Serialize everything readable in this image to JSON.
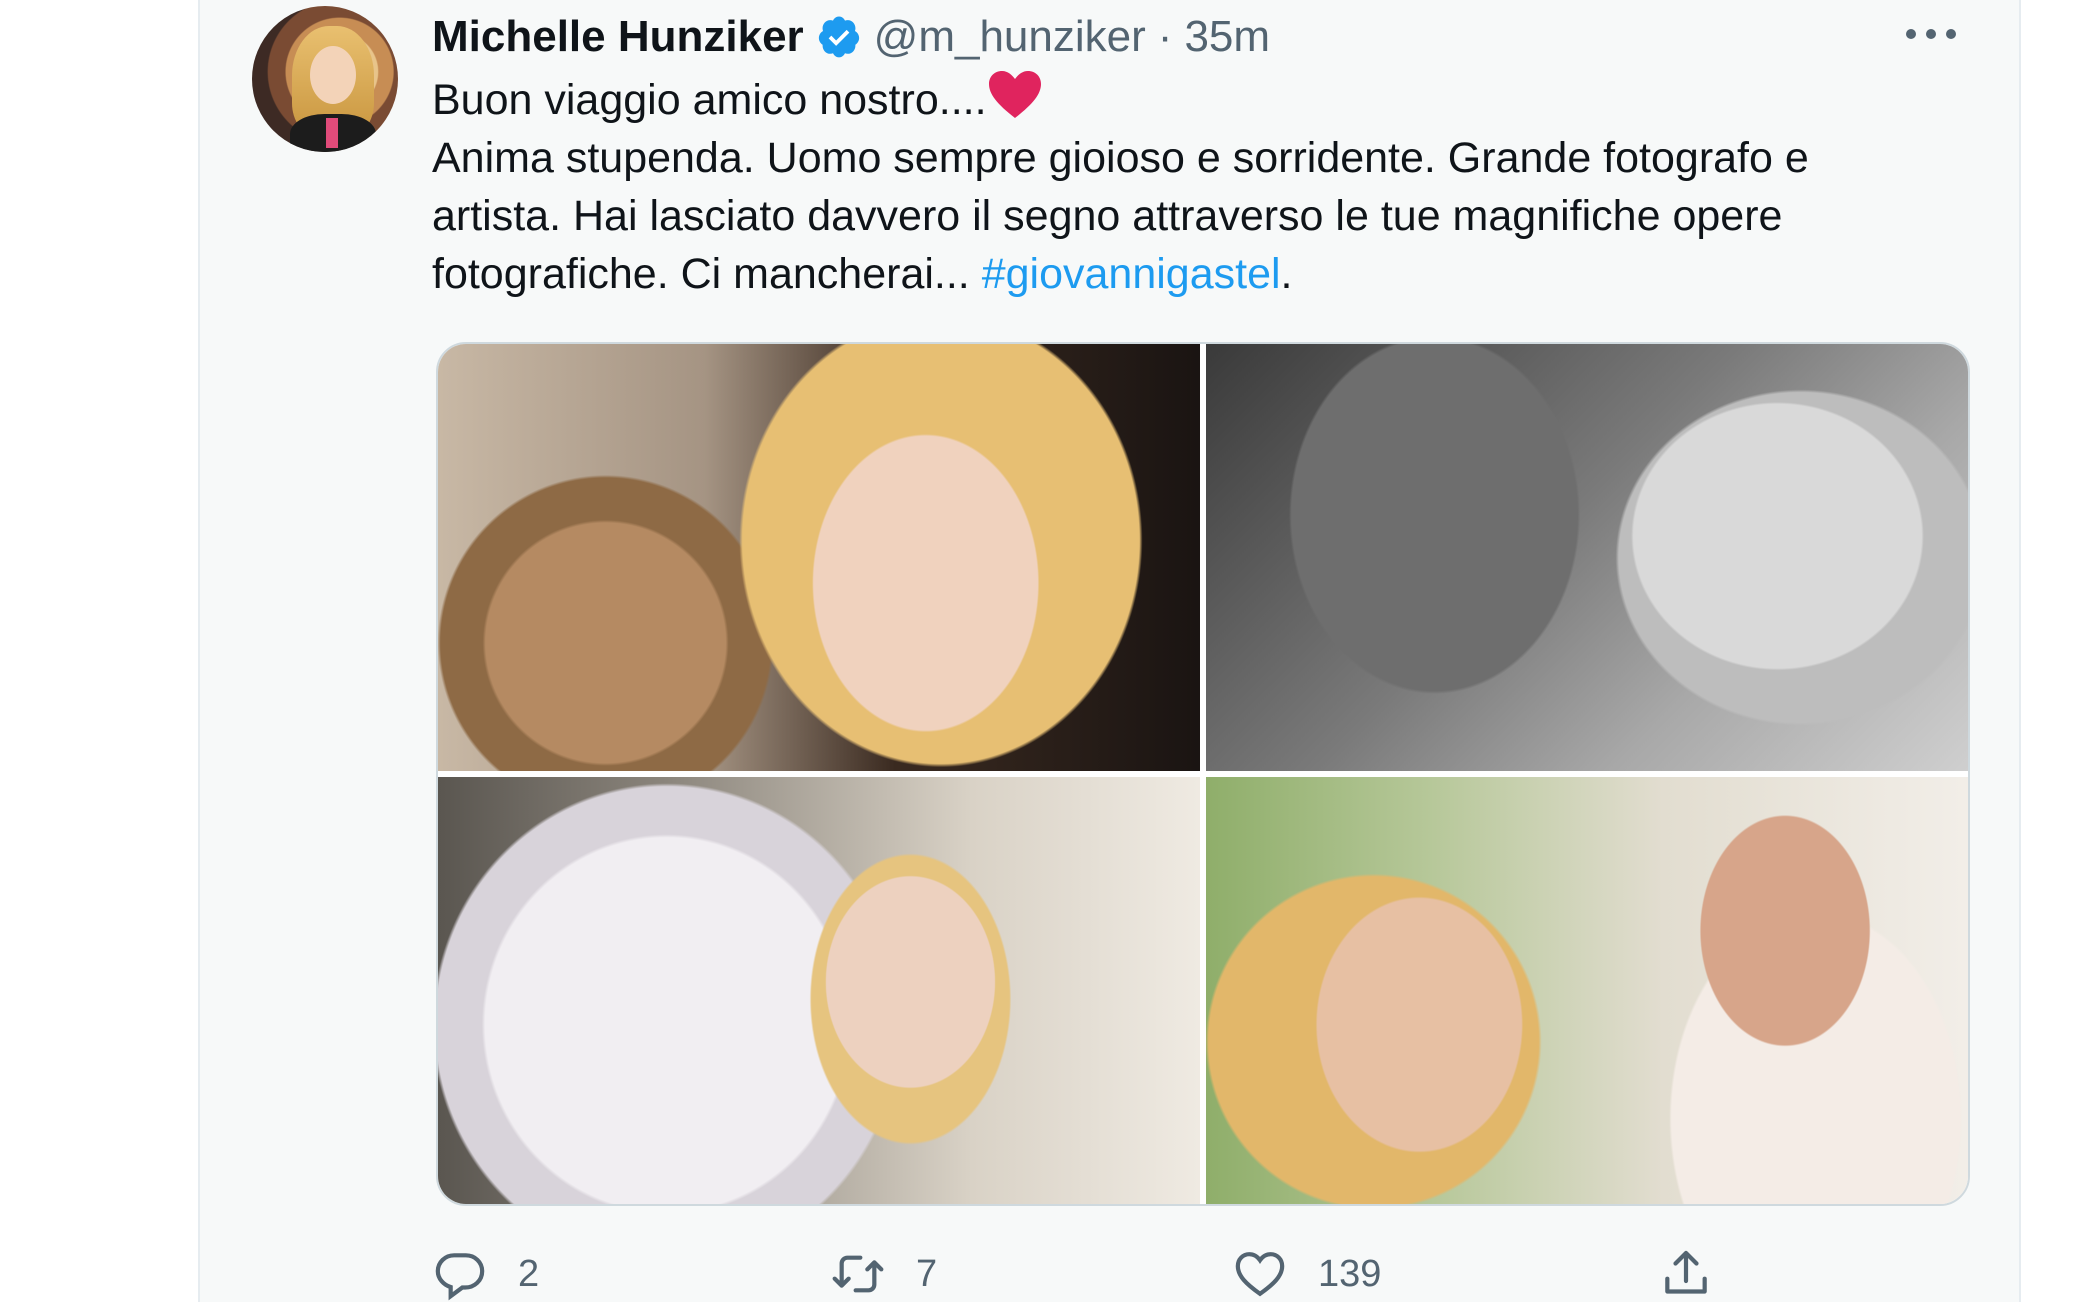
{
  "tweet": {
    "author_name": "Michelle Hunziker",
    "handle": "@m_hunziker",
    "separator": "·",
    "time": "35m",
    "text_lines": [
      "Buon viaggio amico nostro....",
      "Anima stupenda. Uomo sempre gioioso e sorridente. Grande fotografo e",
      "artista. Hai lasciato davvero il segno attraverso le tue magnifiche opere",
      "fotografiche. Ci mancherai... "
    ],
    "hashtag": "#giovannigastel",
    "trailing_punct": ".",
    "emoji": "heart",
    "stats": {
      "replies": "2",
      "retweets": "7",
      "likes": "139"
    },
    "photos": 4
  },
  "colors": {
    "text": "#0f1419",
    "secondary": "#536471",
    "link": "#1d9bf0",
    "verified": "#1d9bf0",
    "heart": "#e0245e",
    "card_bg": "#f7f9f9"
  },
  "icons": {
    "verified": "verified-badge-icon",
    "more": "more-dots-icon",
    "reply": "reply-icon",
    "retweet": "retweet-icon",
    "like": "like-heart-icon",
    "share": "share-icon"
  }
}
